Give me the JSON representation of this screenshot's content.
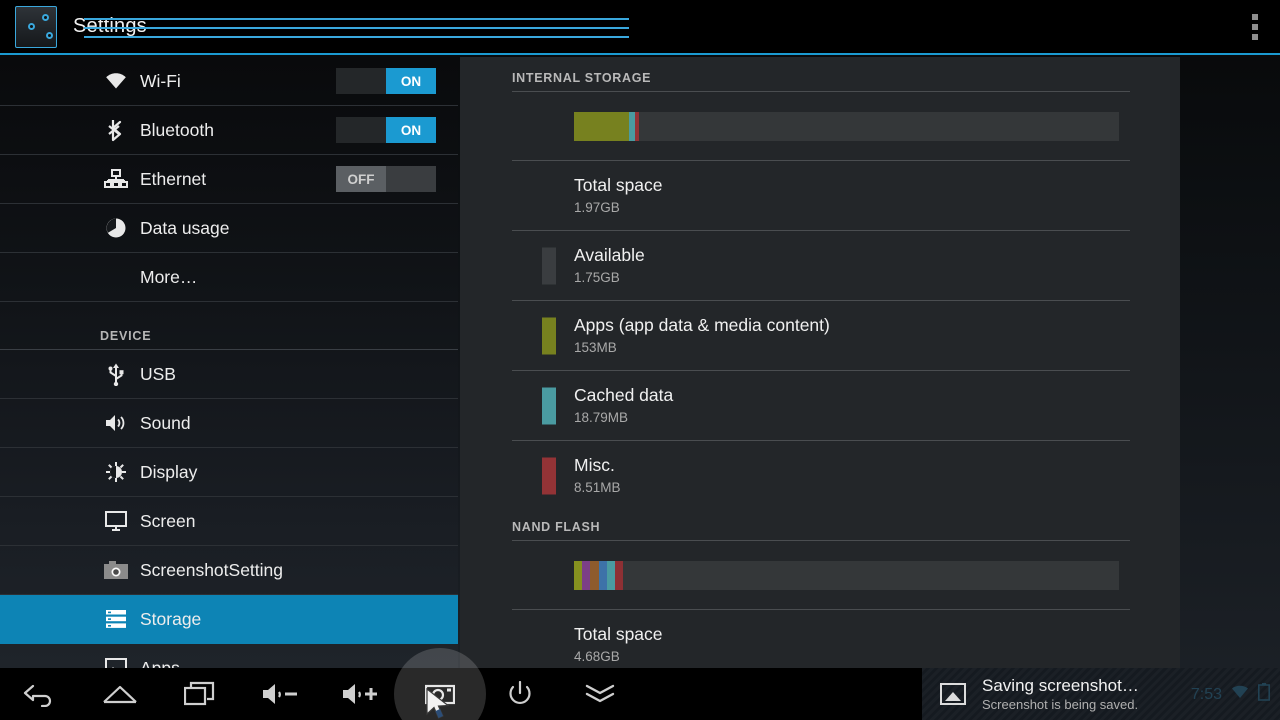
{
  "app": {
    "title": "Settings",
    "icon": "settings-sliders-icon",
    "overflow_icon": "overflow-menu-icon",
    "accent": "#1b9ad1"
  },
  "sidebar": {
    "items": [
      {
        "label": "Wi-Fi",
        "icon": "wifi-icon",
        "toggle": "ON",
        "toggle_state": "on"
      },
      {
        "label": "Bluetooth",
        "icon": "bluetooth-icon",
        "toggle": "ON",
        "toggle_state": "on"
      },
      {
        "label": "Ethernet",
        "icon": "ethernet-icon",
        "toggle": "OFF",
        "toggle_state": "off"
      },
      {
        "label": "Data usage",
        "icon": "data-usage-icon",
        "toggle": null,
        "toggle_state": null
      },
      {
        "label": "More…",
        "icon": null,
        "toggle": null,
        "toggle_state": null
      }
    ],
    "device_header": "DEVICE",
    "device_items": [
      {
        "label": "USB",
        "icon": "usb-icon",
        "selected": false
      },
      {
        "label": "Sound",
        "icon": "sound-icon",
        "selected": false
      },
      {
        "label": "Display",
        "icon": "display-icon",
        "selected": false
      },
      {
        "label": "Screen",
        "icon": "screen-icon",
        "selected": false
      },
      {
        "label": "ScreenshotSetting",
        "icon": "camera-icon",
        "selected": false
      },
      {
        "label": "Storage",
        "icon": "storage-icon",
        "selected": true
      },
      {
        "label": "Apps",
        "icon": "apps-icon",
        "selected": false
      }
    ]
  },
  "storage": {
    "internal": {
      "header": "INTERNAL STORAGE",
      "bar": [
        {
          "name": "apps",
          "color": "#77811f",
          "percent": 10.0
        },
        {
          "name": "cached",
          "color": "#4a9ba1",
          "percent": 1.2
        },
        {
          "name": "misc",
          "color": "#933336",
          "percent": 0.8
        },
        {
          "name": "available",
          "color": "#343739",
          "percent": 88.0
        }
      ],
      "items": [
        {
          "label": "Total space",
          "value": "1.97GB",
          "color": null
        },
        {
          "label": "Available",
          "value": "1.75GB",
          "color": "#3a3d40"
        },
        {
          "label": "Apps (app data & media content)",
          "value": "153MB",
          "color": "#77811f"
        },
        {
          "label": "Cached data",
          "value": "18.79MB",
          "color": "#4a9ba1"
        },
        {
          "label": "Misc.",
          "value": "8.51MB",
          "color": "#933336"
        }
      ]
    },
    "nand": {
      "header": "NAND FLASH",
      "bar": [
        {
          "name": "seg-olive",
          "color": "#85901f",
          "percent": 1.5
        },
        {
          "name": "seg-purple",
          "color": "#7c3f87",
          "percent": 1.5
        },
        {
          "name": "seg-brown",
          "color": "#8e5b2c",
          "percent": 1.5
        },
        {
          "name": "seg-blue",
          "color": "#3d72a8",
          "percent": 1.5
        },
        {
          "name": "seg-teal",
          "color": "#4a9ba1",
          "percent": 1.5
        },
        {
          "name": "seg-red",
          "color": "#8e3034",
          "percent": 1.5
        },
        {
          "name": "free",
          "color": "#343739",
          "percent": 91.0
        }
      ],
      "items": [
        {
          "label": "Total space",
          "value": "4.68GB",
          "color": null
        }
      ]
    }
  },
  "navbar": {
    "buttons": [
      {
        "name": "back-icon",
        "highlight": false
      },
      {
        "name": "home-icon",
        "highlight": false
      },
      {
        "name": "recents-icon",
        "highlight": false
      },
      {
        "name": "volume-down-icon",
        "highlight": false
      },
      {
        "name": "volume-up-icon",
        "highlight": false
      },
      {
        "name": "screenshot-icon",
        "highlight": true
      },
      {
        "name": "power-icon",
        "highlight": false
      },
      {
        "name": "hide-navbar-icon",
        "highlight": false
      }
    ],
    "cursor": "mouse-cursor"
  },
  "notification": {
    "icon": "image-icon",
    "title": "Saving screenshot…",
    "subtitle": "Screenshot is being saved."
  },
  "statusbar": {
    "time": "7:53",
    "wifi_icon": "wifi-status-icon",
    "battery_icon": "battery-status-icon"
  }
}
